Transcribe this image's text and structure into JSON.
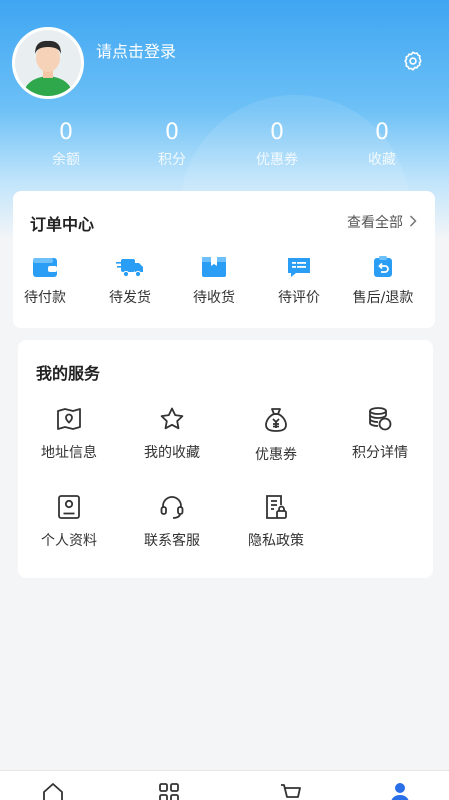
{
  "header": {
    "login_prompt": "请点击登录"
  },
  "stats": [
    {
      "value": "0",
      "label": "余额"
    },
    {
      "value": "0",
      "label": "积分"
    },
    {
      "value": "0",
      "label": "优惠券"
    },
    {
      "value": "0",
      "label": "收藏"
    }
  ],
  "orders": {
    "title": "订单中心",
    "view_all": "查看全部",
    "items": [
      {
        "label": "待付款",
        "icon": "wallet-icon"
      },
      {
        "label": "待发货",
        "icon": "truck-icon"
      },
      {
        "label": "待收货",
        "icon": "box-icon"
      },
      {
        "label": "待评价",
        "icon": "comment-icon"
      },
      {
        "label": "售后/退款",
        "icon": "refund-icon"
      }
    ]
  },
  "services": {
    "title": "我的服务",
    "items": [
      {
        "label": "地址信息",
        "icon": "map-icon"
      },
      {
        "label": "我的收藏",
        "icon": "star-icon"
      },
      {
        "label": "优惠券",
        "icon": "money-bag-icon"
      },
      {
        "label": "积分详情",
        "icon": "coins-icon"
      },
      {
        "label": "个人资料",
        "icon": "profile-card-icon"
      },
      {
        "label": "联系客服",
        "icon": "headset-icon"
      },
      {
        "label": "隐私政策",
        "icon": "policy-lock-icon"
      }
    ]
  },
  "colors": {
    "accent": "#2a9df4",
    "hero_top": "#3fa6f2",
    "background": "#f4f5f7",
    "icon_dark": "#333333"
  },
  "tabbar": {
    "items": [
      "home-icon",
      "category-icon",
      "cart-icon",
      "user-icon"
    ],
    "active": "user-icon"
  }
}
